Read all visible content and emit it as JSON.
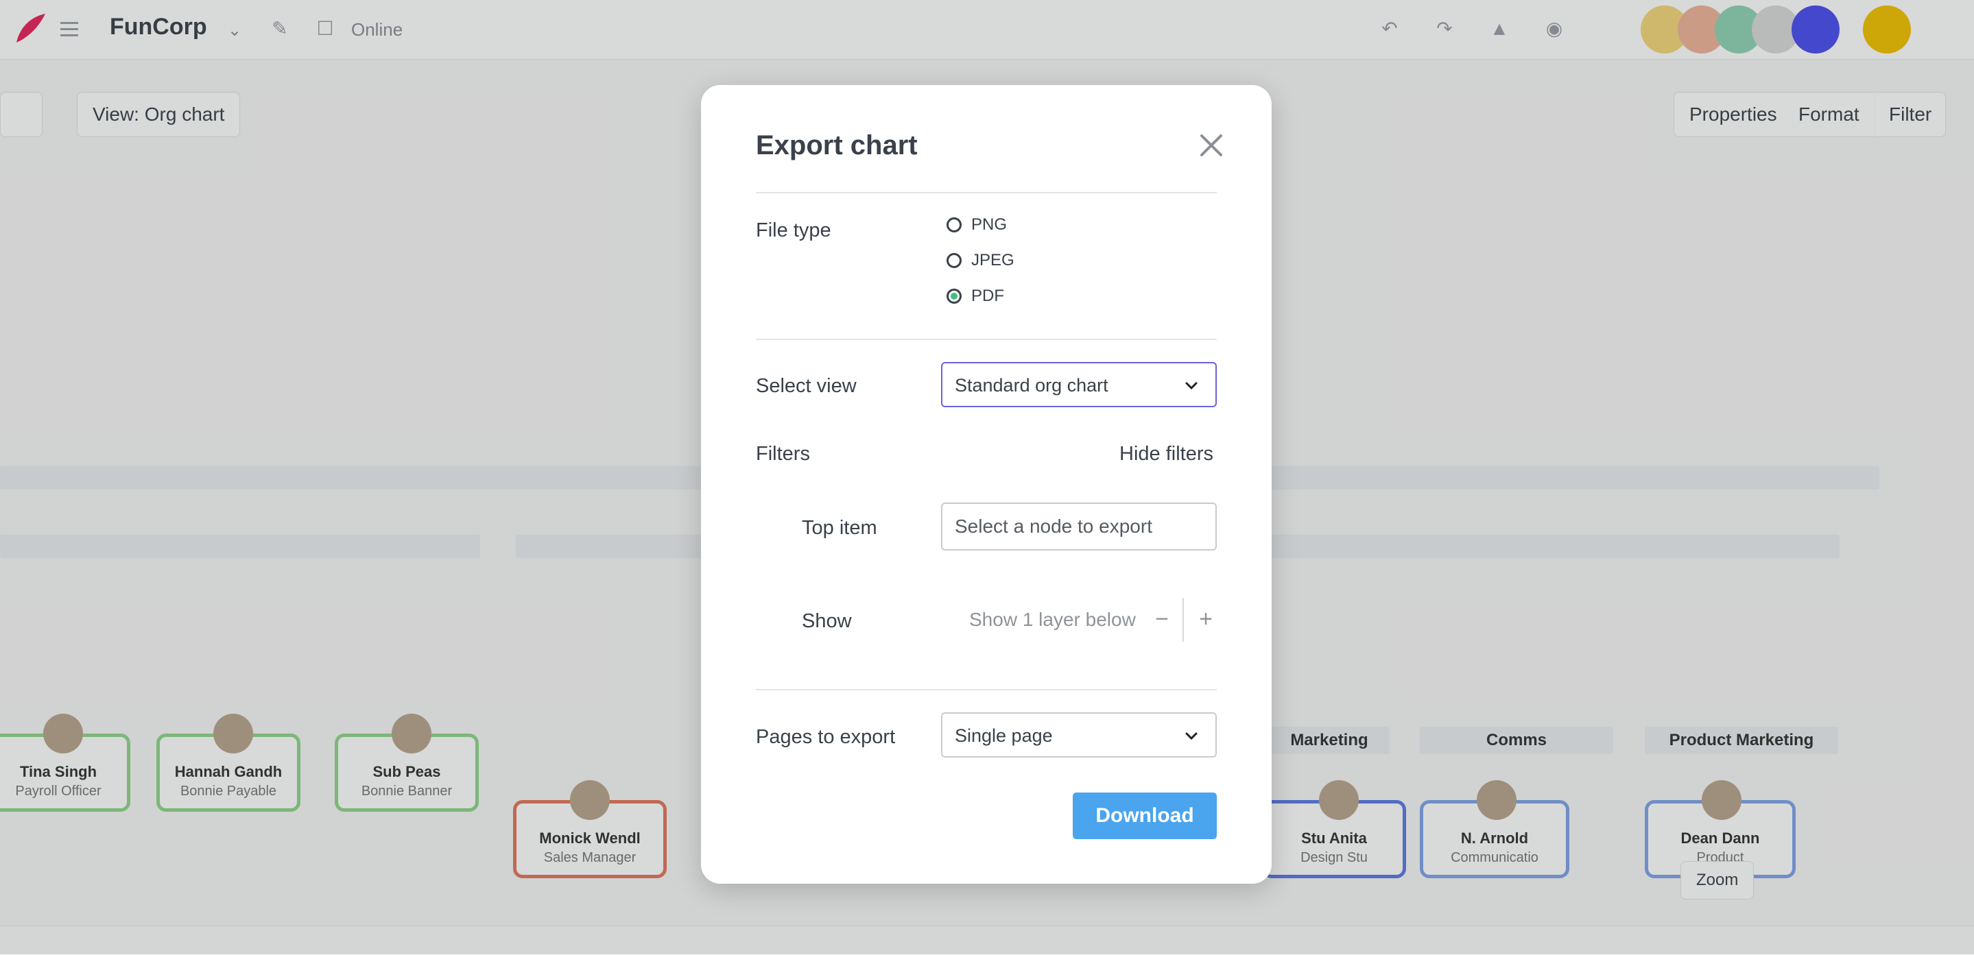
{
  "background": {
    "app_title": "FunCorp",
    "online_label": "Online",
    "view_button": "View: Org chart",
    "right_buttons": [
      "Properties",
      "Format",
      "Filter"
    ],
    "nodes": [
      {
        "name": "Tina Singh",
        "role": "Payroll Officer",
        "color": "#8fd68a"
      },
      {
        "name": "Hannah Gandh",
        "role": "Bonnie Payable",
        "color": "#8fd68a"
      },
      {
        "name": "Sub Peas",
        "role": "Bonnie Banner",
        "color": "#8fd68a"
      },
      {
        "name": "Monick Wendl",
        "role": "Sales Manager",
        "color": "#e3775b"
      },
      {
        "name": "Stu Anita",
        "role": "Design Stu",
        "color": "#5b7be3"
      },
      {
        "name": "N. Arnold",
        "role": "Communicatio",
        "color": "#7fa4ea"
      },
      {
        "name": "Dean Dann",
        "role": "Product",
        "color": "#7fa4ea"
      }
    ],
    "groups": [
      "Marketing",
      "Comms",
      "Product Marketing"
    ],
    "zoom_label": "Zoom"
  },
  "modal": {
    "title": "Export chart",
    "file_type_label": "File type",
    "file_types": [
      {
        "label": "PNG",
        "selected": false
      },
      {
        "label": "JPEG",
        "selected": false
      },
      {
        "label": "PDF",
        "selected": true
      }
    ],
    "select_view_label": "Select view",
    "select_view_value": "Standard org chart",
    "filters_label": "Filters",
    "hide_filters": "Hide filters",
    "top_item_label": "Top item",
    "top_item_placeholder": "Select a node to export",
    "show_label": "Show",
    "show_value": "Show 1 layer below",
    "pages_label": "Pages to export",
    "pages_value": "Single page",
    "download_label": "Download",
    "accent_color": "#4aa4ee",
    "focus_color": "#6b63d6",
    "radio_selected_color": "#3fbf7f"
  }
}
